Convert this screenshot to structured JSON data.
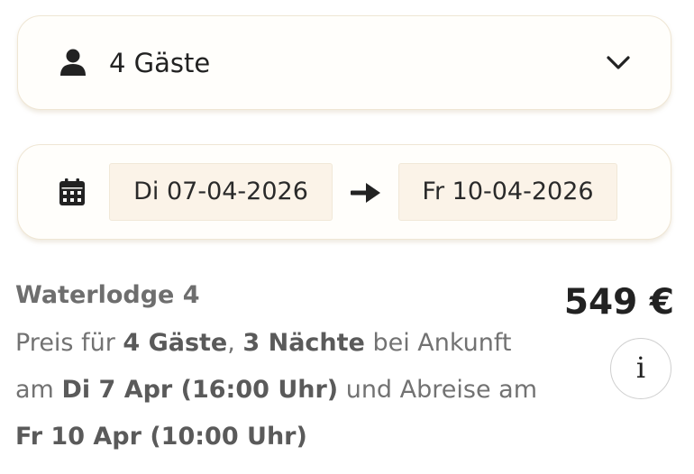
{
  "guests": {
    "label": "4 Gäste",
    "icon": "person-icon",
    "toggle_icon": "chevron-down-icon"
  },
  "dates": {
    "icon": "calendar-icon",
    "start": "Di 07-04-2026",
    "separator_icon": "arrow-right-icon",
    "end": "Fr 10-04-2026"
  },
  "listing": {
    "title": "Waterlodge 4",
    "price": "549 €",
    "info_label": "i",
    "desc": {
      "t1": "Preis für ",
      "guests": "4 Gäste",
      "t2": ", ",
      "nights": "3 Nächte",
      "t3": " bei Ankunft am ",
      "arrival": "Di 7 Apr (16:00 Uhr)",
      "t4": " und Abreise am ",
      "departure": "Fr 10 Apr (10:00 Uhr)"
    }
  },
  "colors": {
    "card_background": "#fffefb",
    "card_border": "#efe6d4",
    "date_field_background": "#fbf3e8",
    "text_primary": "#222222",
    "text_secondary": "#727272"
  }
}
